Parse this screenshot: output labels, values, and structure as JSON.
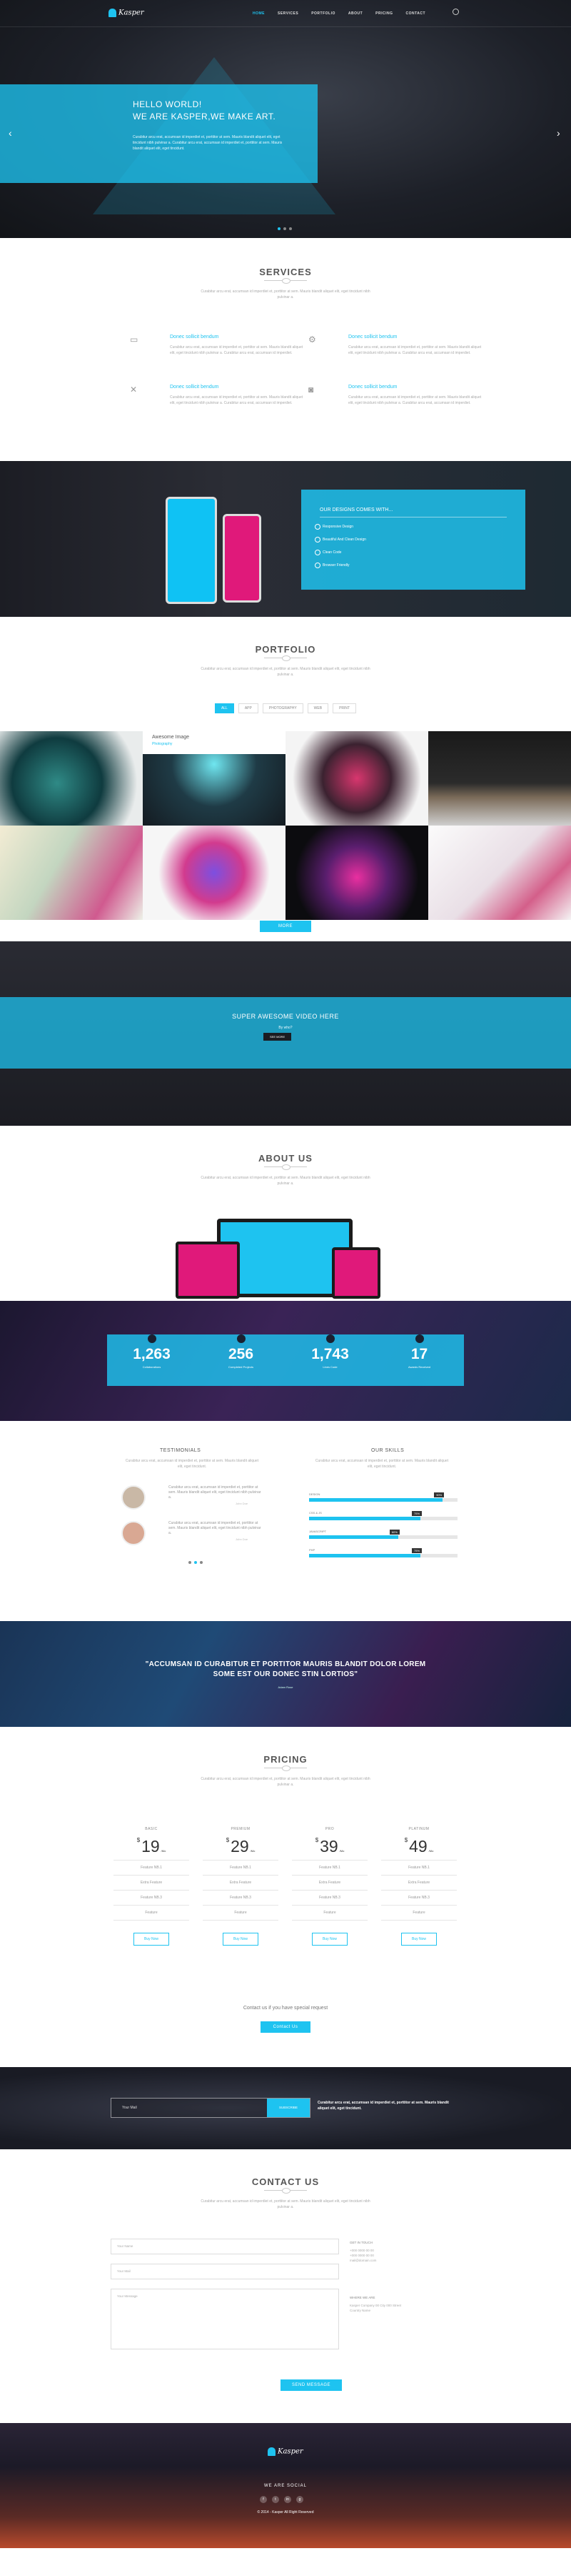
{
  "brand": {
    "name": "Kasper",
    "accent": "#1ec3f0"
  },
  "nav": {
    "items": [
      "HOME",
      "SERVICES",
      "PORTFOLIO",
      "ABOUT",
      "PRICING",
      "CONTACT"
    ],
    "active": "HOME"
  },
  "hero": {
    "line1": "HELLO WORLD!",
    "line2": "WE ARE KASPER,WE MAKE ART.",
    "text": "Curabitur arcu erat, accumsan id imperdiet et, porttitor at sem. Mauris blandit aliquet elit, eget tincidunt nibh pulvinar a. Curabitur arcu erat, accumsan id imperdiet et, porttitor at sem. Mauris blandit aliquet elit, eget tincidunt."
  },
  "services": {
    "title": "SERVICES",
    "subtitle": "Curabitur arcu erat, accumsan id imperdiet et, porttitor at sem. Mauris blandit aliquet elit, eget tincidunt nibh pulvinar a.",
    "items": [
      {
        "icon": "monitor-icon",
        "title": "Donec sollicit bendum",
        "text": "Curabitur arcu erat, accumsan id imperdiet et, porttitor at sem. Mauris blandit aliquet elit, eget tincidunt nibh pulvinar a. Curabitur arcu erat, accumsan id imperdiet."
      },
      {
        "icon": "gear-icon",
        "title": "Donec sollicit bendum",
        "text": "Curabitur arcu erat, accumsan id imperdiet et, porttitor at sem. Mauris blandit aliquet elit, eget tincidunt nibh pulvinar a. Curabitur arcu erat, accumsan id imperdiet."
      },
      {
        "icon": "tools-icon",
        "title": "Donec sollicit bendum",
        "text": "Curabitur arcu erat, accumsan id imperdiet et, porttitor at sem. Mauris blandit aliquet elit, eget tincidunt nibh pulvinar a. Curabitur arcu erat, accumsan id imperdiet."
      },
      {
        "icon": "camera-icon",
        "title": "Donec sollicit bendum",
        "text": "Curabitur arcu erat, accumsan id imperdiet et, porttitor at sem. Mauris blandit aliquet elit, eget tincidunt nibh pulvinar a. Curabitur arcu erat, accumsan id imperdiet."
      }
    ]
  },
  "features": {
    "title": "OUR DESIGNS COMES WITH...",
    "items": [
      "Responsive Design",
      "Beautiful And Clean Design",
      "Clean Code",
      "Browser Friendly"
    ]
  },
  "portfolio": {
    "title": "PORTFOLIO",
    "subtitle": "Curabitur arcu erat, accumsan id imperdiet et, porttitor at sem. Mauris blandit aliquet elit, eget tincidunt nibh pulvinar a.",
    "filters": [
      "ALL",
      "APP",
      "PHOTOGRAPHY",
      "WEB",
      "PRINT"
    ],
    "active_filter": "ALL",
    "caption_title": "Awesome Image",
    "caption_tag": "Photography",
    "more_label": "MORE"
  },
  "video": {
    "title": "SUPER AWESOME VIDEO HERE",
    "subtitle": "By who?",
    "button": "SEE MORE"
  },
  "about": {
    "title": "ABOUT US",
    "subtitle": "Curabitur arcu erat, accumsan id imperdiet et, porttitor at sem. Mauris blandit aliquet elit, eget tincidunt nibh pulvinar a."
  },
  "stats": [
    {
      "value": "1,263",
      "label": "Collaborations"
    },
    {
      "value": "256",
      "label": "Completed Projects"
    },
    {
      "value": "1,743",
      "label": "Lines Code"
    },
    {
      "value": "17",
      "label": "Awards Received"
    }
  ],
  "testimonials": {
    "title": "TESTIMONIALS",
    "subtitle": "Curabitur arcu erat, accumsan id imperdiet et, porttitor at sem. Mauris blandit aliquet elit, eget tincidunt.",
    "items": [
      {
        "text": "Curabitur arcu erat, accumsan id imperdiet et, porttitor at sem. Mauris blandit aliquet elit, eget tincidunt nibh pulvinar a.",
        "author": "John Doe"
      },
      {
        "text": "Curabitur arcu erat, accumsan id imperdiet et, porttitor at sem. Mauris blandit aliquet elit, eget tincidunt nibh pulvinar a.",
        "author": "John Doe"
      }
    ]
  },
  "skills": {
    "title": "OUR SKILLS",
    "subtitle": "Curabitur arcu erat, accumsan id imperdiet et, porttitor at sem. Mauris blandit aliquet elit, eget tincidunt.",
    "items": [
      {
        "name": "DESIGN",
        "level": 0.9,
        "label": "90%"
      },
      {
        "name": "CSS & JS",
        "level": 0.75,
        "label": "75%"
      },
      {
        "name": "JAVASCRIPT",
        "level": 0.6,
        "label": "60%"
      },
      {
        "name": "PHP",
        "level": 0.75,
        "label": "75%"
      }
    ]
  },
  "bigquote": {
    "text": "\"ACCUMSAN ID CURABITUR ET PORTITOR MAURIS BLANDIT DOLOR LOREM SOME EST OUR DONEC STIN LORTIOS\"",
    "author": "Adam Rose"
  },
  "pricing": {
    "title": "PRICING",
    "subtitle": "Curabitur arcu erat, accumsan id imperdiet et, porttitor at sem. Mauris blandit aliquet elit, eget tincidunt nibh pulvinar a.",
    "plans": [
      {
        "name": "BASIC",
        "currency": "$",
        "price": "19",
        "period": "/Mo",
        "rows": [
          "Feature NB.1",
          "Extra Feature",
          "Feature NB.3",
          "Feature"
        ],
        "button": "Buy Now"
      },
      {
        "name": "PREMIUM",
        "currency": "$",
        "price": "29",
        "period": "/Mo",
        "rows": [
          "Feature NB.1",
          "Extra Feature",
          "Feature NB.3",
          "Feature"
        ],
        "button": "Buy Now"
      },
      {
        "name": "PRO",
        "currency": "$",
        "price": "39",
        "period": "/Mo",
        "rows": [
          "Feature NB.1",
          "Extra Feature",
          "Feature NB.3",
          "Feature"
        ],
        "button": "Buy Now"
      },
      {
        "name": "PLATINUM",
        "currency": "$",
        "price": "49",
        "period": "/Mo",
        "rows": [
          "Feature NB.1",
          "Extra Feature",
          "Feature NB.3",
          "Feature"
        ],
        "button": "Buy Now"
      }
    ],
    "special_text": "Contact us if you have special request",
    "contact_button": "Contact Us"
  },
  "newsletter": {
    "placeholder": "Your Mail",
    "button": "SUBSCRIBE",
    "text": "Curabitur arcu erat, accumsan id imperdiet et, porttitor at sem. Mauris blandit aliquet elit, eget tincidunt."
  },
  "contact": {
    "title": "CONTACT US",
    "subtitle": "Curabitur arcu erat, accumsan id imperdiet et, porttitor at sem. Mauris blandit aliquet elit, eget tincidunt nibh pulvinar a.",
    "fields": [
      "Your Name",
      "Your Mail",
      "Your Message"
    ],
    "send": "SEND MESSAGE",
    "info1_title": "GET IN TOUCH",
    "info1_text": "+000 0000 00 00\n+000 0000 00 00\nmail@domain.com",
    "info2_title": "WHERE WE ARE",
    "info2_text": "Kasper Company 00 City 000 Street\nCountry Name"
  },
  "footer": {
    "social_title": "WE ARE SOCIAL",
    "copyright": "© 2014 - Kasper All Right Reserved",
    "social": [
      "f",
      "t",
      "in",
      "g"
    ]
  }
}
